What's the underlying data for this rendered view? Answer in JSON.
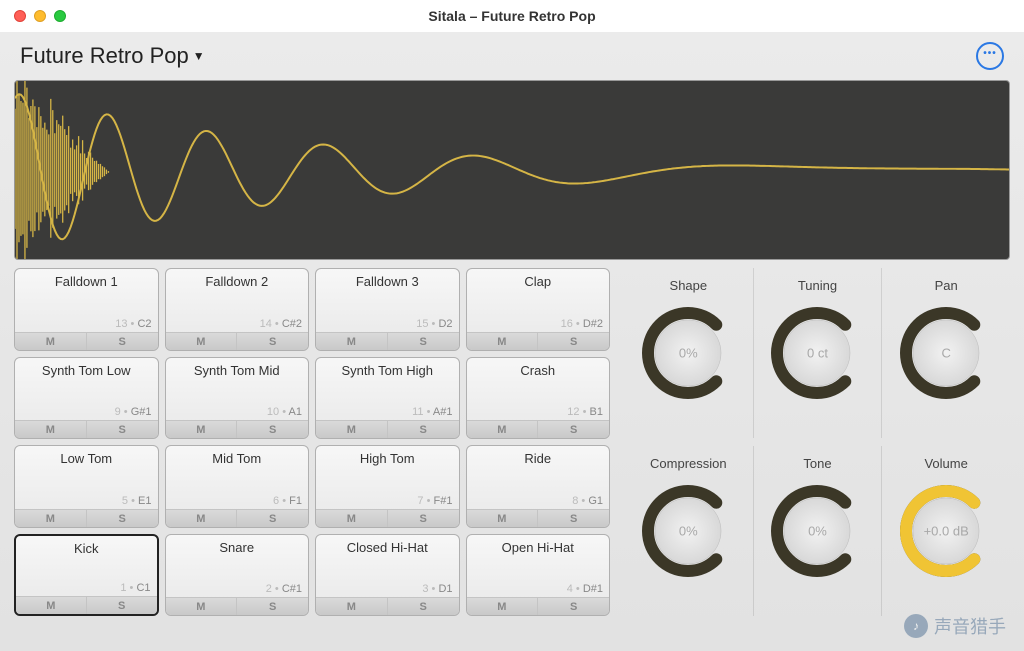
{
  "window": {
    "title": "Sitala – Future Retro Pop"
  },
  "kit": {
    "name": "Future Retro Pop"
  },
  "waveform": {
    "color": "#d5b546"
  },
  "pads": [
    {
      "name": "Falldown 1",
      "idx": 13,
      "note": "C2",
      "selected": false
    },
    {
      "name": "Falldown 2",
      "idx": 14,
      "note": "C#2",
      "selected": false
    },
    {
      "name": "Falldown 3",
      "idx": 15,
      "note": "D2",
      "selected": false
    },
    {
      "name": "Clap",
      "idx": 16,
      "note": "D#2",
      "selected": false
    },
    {
      "name": "Synth Tom Low",
      "idx": 9,
      "note": "G#1",
      "selected": false
    },
    {
      "name": "Synth Tom Mid",
      "idx": 10,
      "note": "A1",
      "selected": false
    },
    {
      "name": "Synth Tom High",
      "idx": 11,
      "note": "A#1",
      "selected": false
    },
    {
      "name": "Crash",
      "idx": 12,
      "note": "B1",
      "selected": false
    },
    {
      "name": "Low Tom",
      "idx": 5,
      "note": "E1",
      "selected": false
    },
    {
      "name": "Mid Tom",
      "idx": 6,
      "note": "F1",
      "selected": false
    },
    {
      "name": "High Tom",
      "idx": 7,
      "note": "F#1",
      "selected": false
    },
    {
      "name": "Ride",
      "idx": 8,
      "note": "G1",
      "selected": false
    },
    {
      "name": "Kick",
      "idx": 1,
      "note": "C1",
      "selected": true
    },
    {
      "name": "Snare",
      "idx": 2,
      "note": "C#1",
      "selected": false
    },
    {
      "name": "Closed Hi-Hat",
      "idx": 3,
      "note": "D1",
      "selected": false
    },
    {
      "name": "Open Hi-Hat",
      "idx": 4,
      "note": "D#1",
      "selected": false
    }
  ],
  "pad_ms": {
    "m": "M",
    "s": "S"
  },
  "knobs": [
    {
      "label": "Shape",
      "value": "0%",
      "fill": 0.0,
      "color": "#3b3727"
    },
    {
      "label": "Tuning",
      "value": "0 ct",
      "fill": 0.0,
      "color": "#3b3727"
    },
    {
      "label": "Pan",
      "value": "C",
      "fill": 0.0,
      "color": "#3b3727"
    },
    {
      "label": "Compression",
      "value": "0%",
      "fill": 0.0,
      "color": "#3b3727"
    },
    {
      "label": "Tone",
      "value": "0%",
      "fill": 0.0,
      "color": "#3b3727"
    },
    {
      "label": "Volume",
      "value": "+0.0 dB",
      "fill": 1.0,
      "color": "#f0c434"
    }
  ],
  "watermark": {
    "text": "声音猎手"
  }
}
